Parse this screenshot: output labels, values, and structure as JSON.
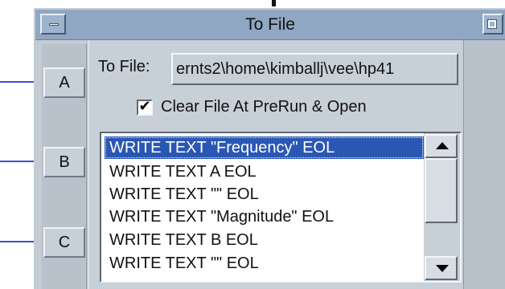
{
  "window": {
    "title": "To File"
  },
  "inputs": [
    {
      "label": "A"
    },
    {
      "label": "B"
    },
    {
      "label": "C"
    }
  ],
  "file": {
    "label": "To File:",
    "path": "ernts2\\home\\kimballj\\vee\\hp41"
  },
  "clear_option": {
    "label": "Clear File At PreRun & Open",
    "checked": true
  },
  "transactions": [
    "WRITE TEXT \"Frequency\" EOL",
    "WRITE TEXT A EOL",
    "WRITE TEXT \"\" EOL",
    "WRITE TEXT \"Magnitude\" EOL",
    "WRITE TEXT B EOL",
    "WRITE TEXT \"\" EOL"
  ],
  "selected_index": 0,
  "colors": {
    "title_bar": "#8fa7c2",
    "panel": "#c7cfd7",
    "selection": "#2a57b4",
    "wire": "#3b4fd8"
  },
  "icons": {
    "title_left": "minimize-icon",
    "title_right": "maximize-icon",
    "scroll_up": "arrow-up-icon",
    "scroll_down": "arrow-down-icon"
  }
}
